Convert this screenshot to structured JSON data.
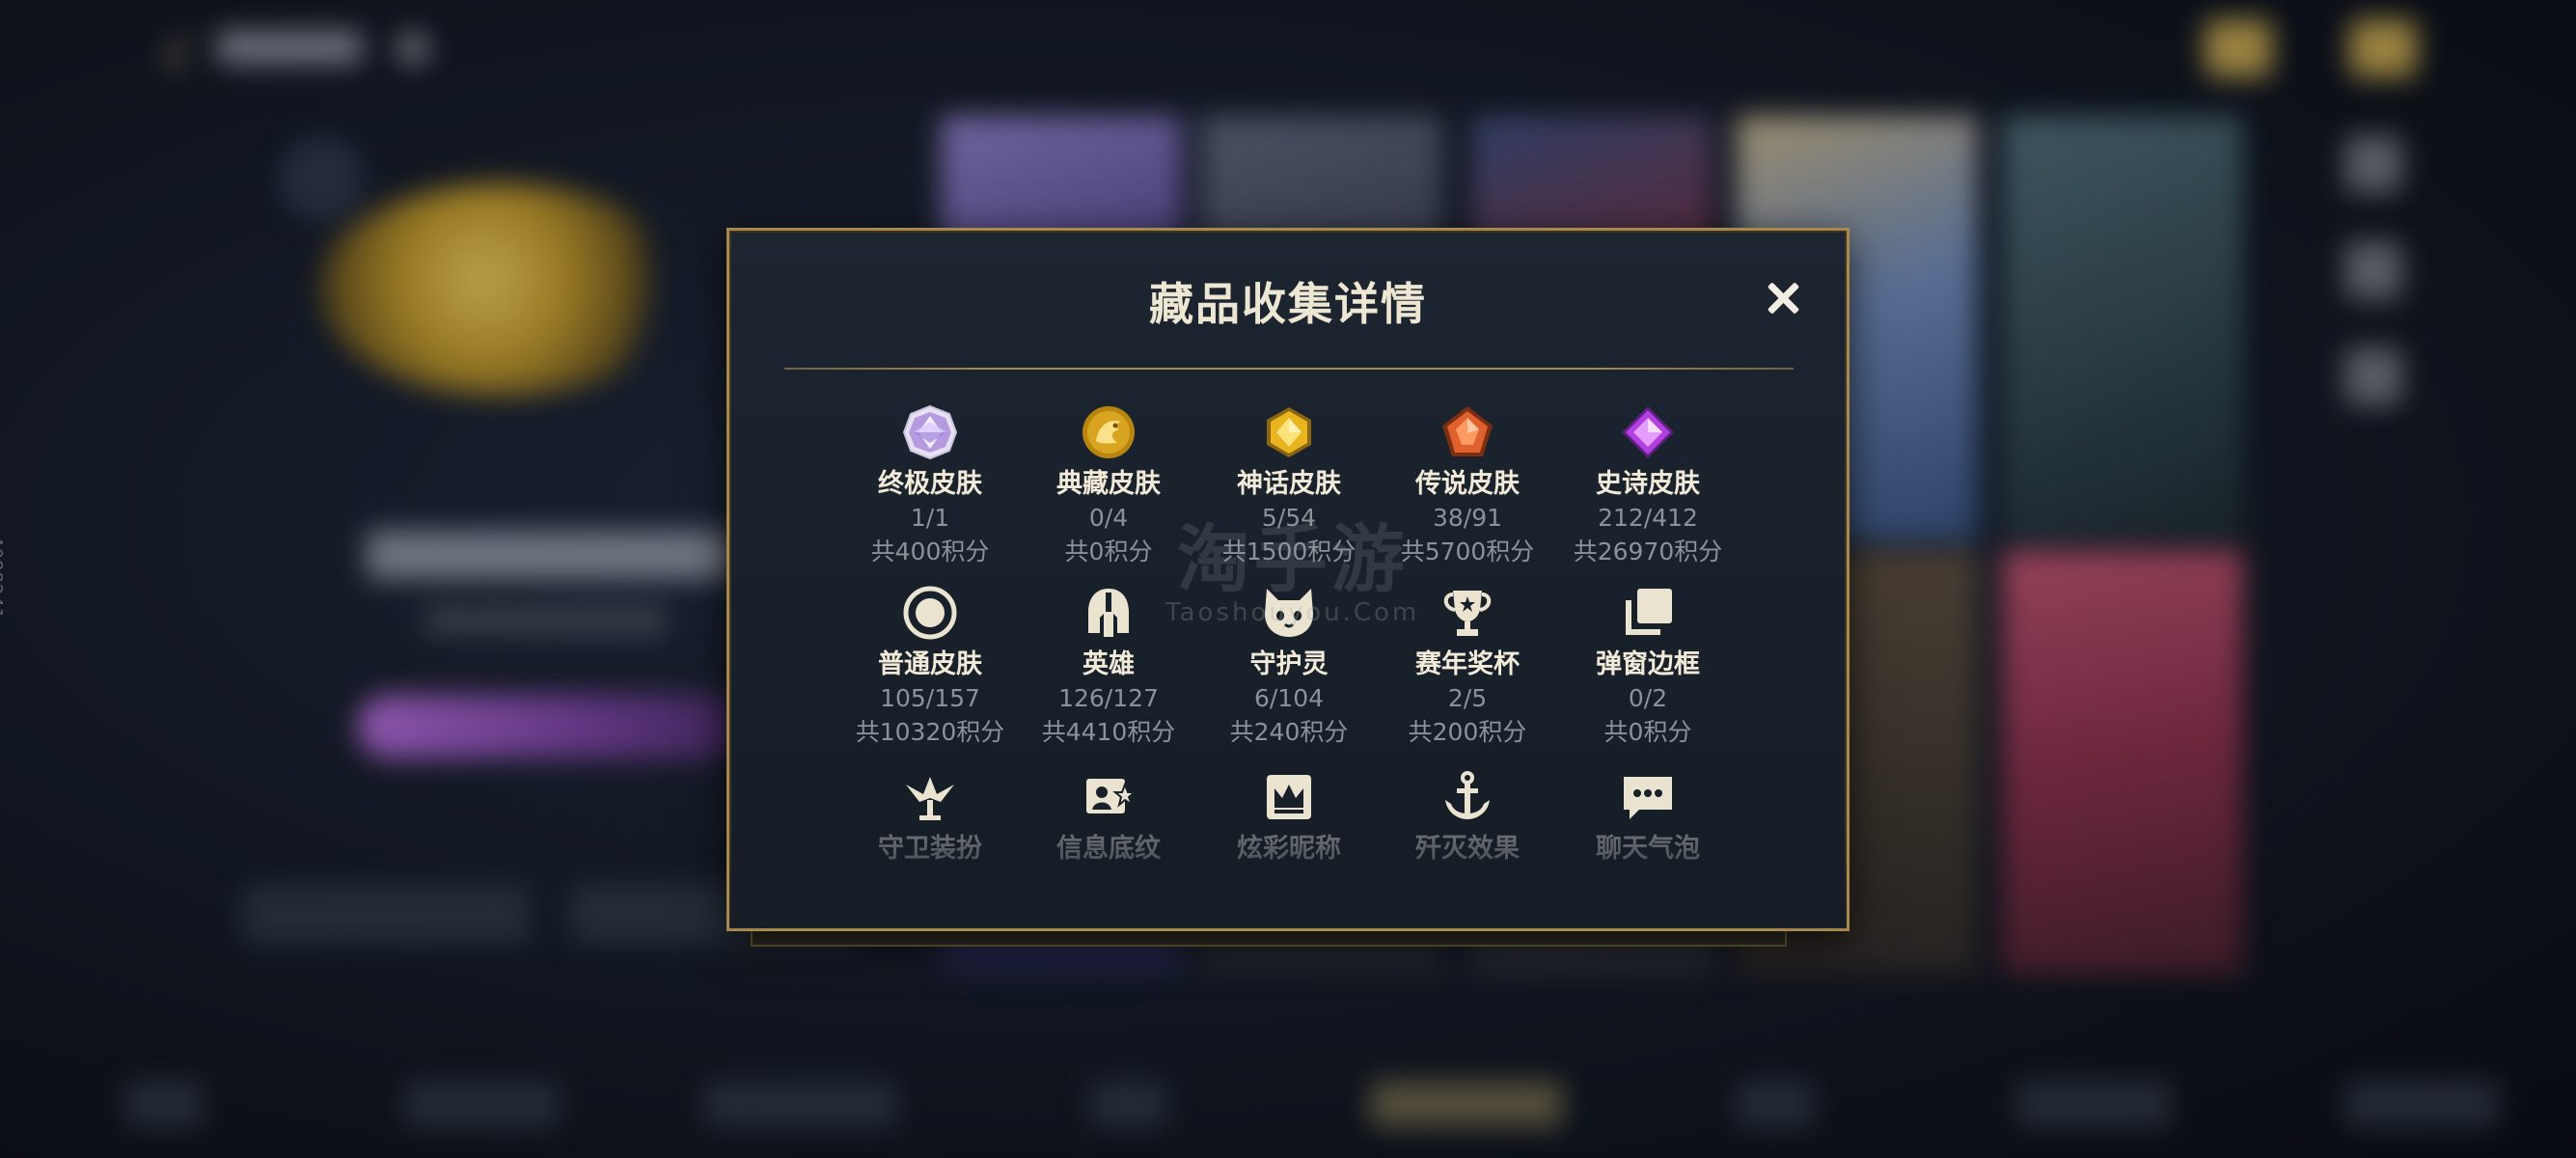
{
  "modal": {
    "title": "藏品收集详情",
    "close_icon": "close-icon"
  },
  "rows": [
    [
      {
        "icon": "ultimate-skin-gem-icon",
        "name": "终极皮肤",
        "count": "1/1",
        "points": "共400积分"
      },
      {
        "icon": "prestige-skin-dragon-icon",
        "name": "典藏皮肤",
        "count": "0/4",
        "points": "共0积分"
      },
      {
        "icon": "mythic-skin-gem-icon",
        "name": "神话皮肤",
        "count": "5/54",
        "points": "共1500积分"
      },
      {
        "icon": "legendary-skin-gem-icon",
        "name": "传说皮肤",
        "count": "38/91",
        "points": "共5700积分"
      },
      {
        "icon": "epic-skin-gem-icon",
        "name": "史诗皮肤",
        "count": "212/412",
        "points": "共26970积分"
      }
    ],
    [
      {
        "icon": "normal-skin-ring-icon",
        "name": "普通皮肤",
        "count": "105/157",
        "points": "共10320积分"
      },
      {
        "icon": "champion-helmet-icon",
        "name": "英雄",
        "count": "126/127",
        "points": "共4410积分"
      },
      {
        "icon": "guardian-spirit-icon",
        "name": "守护灵",
        "count": "6/104",
        "points": "共240积分"
      },
      {
        "icon": "trophy-icon",
        "name": "赛年奖杯",
        "count": "2/5",
        "points": "共200积分"
      },
      {
        "icon": "frame-layers-icon",
        "name": "弹窗边框",
        "count": "0/2",
        "points": "共0积分"
      }
    ],
    [
      {
        "icon": "ward-skin-icon",
        "name": "守卫装扮"
      },
      {
        "icon": "profile-banner-icon",
        "name": "信息底纹"
      },
      {
        "icon": "nickname-crown-icon",
        "name": "炫彩昵称"
      },
      {
        "icon": "finisher-anchor-icon",
        "name": "歼灭效果"
      },
      {
        "icon": "chat-bubble-icon",
        "name": "聊天气泡"
      }
    ]
  ],
  "watermark": {
    "main": "淘手游",
    "sub": "Taoshouyou.Com"
  },
  "side_id": "4088241",
  "colors": {
    "accent_gold": "#a8894d",
    "title_text": "#ede6d2",
    "muted_text": "#8c929a"
  }
}
